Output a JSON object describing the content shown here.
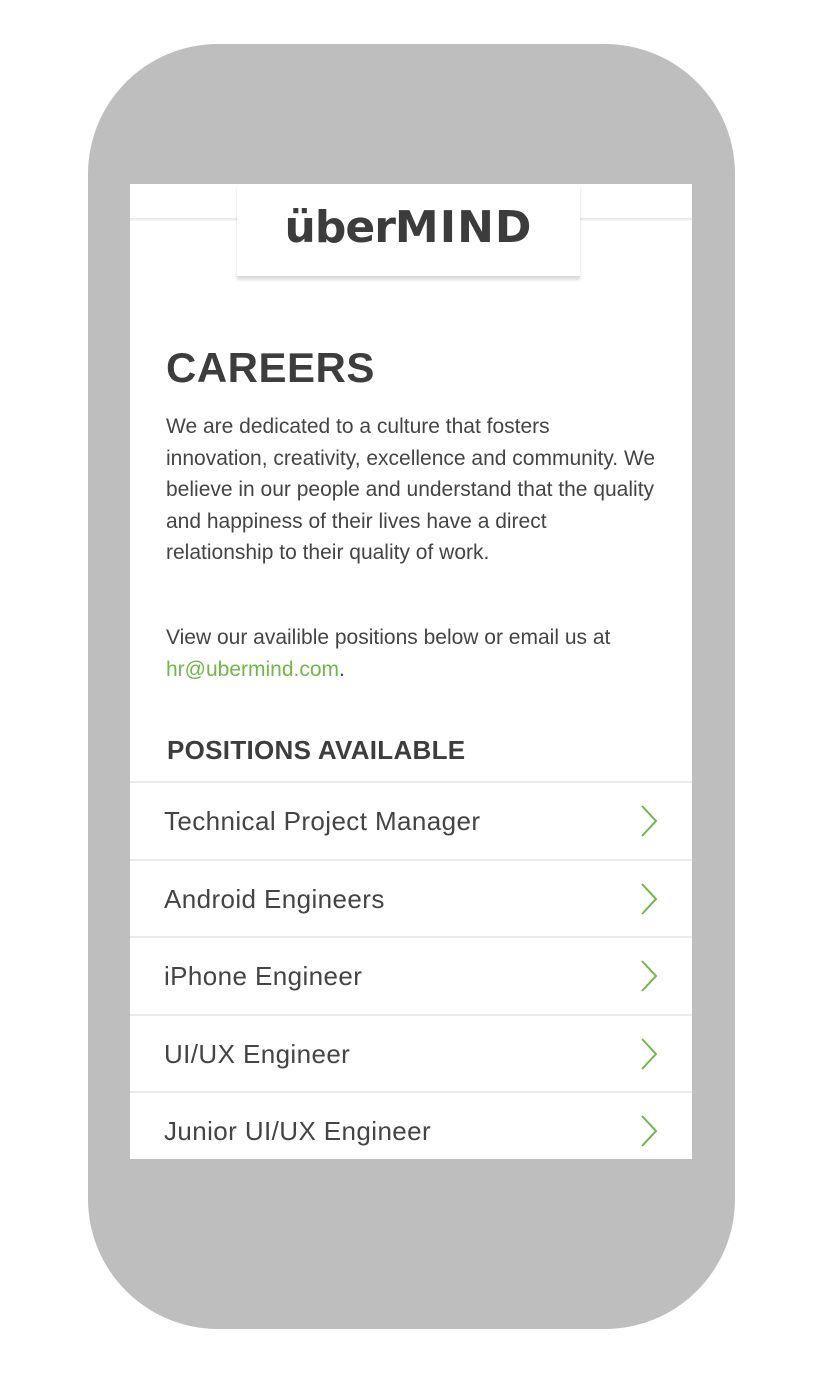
{
  "header": {
    "logo_lower": "über",
    "logo_upper": "MIND"
  },
  "main": {
    "title": "CAREERS",
    "intro": "We are dedicated to a culture that fosters innovation, creativity, excellence and community. We believe in our people and understand that the quality and happiness of their lives have a direct relationship to their quality of work.",
    "contact_prefix": "View our availible positions below or email us at ",
    "contact_email": "hr@ubermind.com",
    "contact_suffix": "."
  },
  "positions": {
    "heading": "POSITIONS AVAILABLE",
    "items": [
      {
        "label": "Technical Project Manager",
        "icon": "chevron-right-icon"
      },
      {
        "label": "Android Engineers",
        "icon": "chevron-right-icon"
      },
      {
        "label": "iPhone Engineer",
        "icon": "chevron-right-icon"
      },
      {
        "label": "UI/UX Engineer",
        "icon": "chevron-right-icon"
      },
      {
        "label": "Junior UI/UX Engineer",
        "icon": "chevron-right-icon"
      }
    ]
  },
  "colors": {
    "accent": "#72b64a",
    "text": "#444444",
    "device_frame": "#bebebe"
  }
}
